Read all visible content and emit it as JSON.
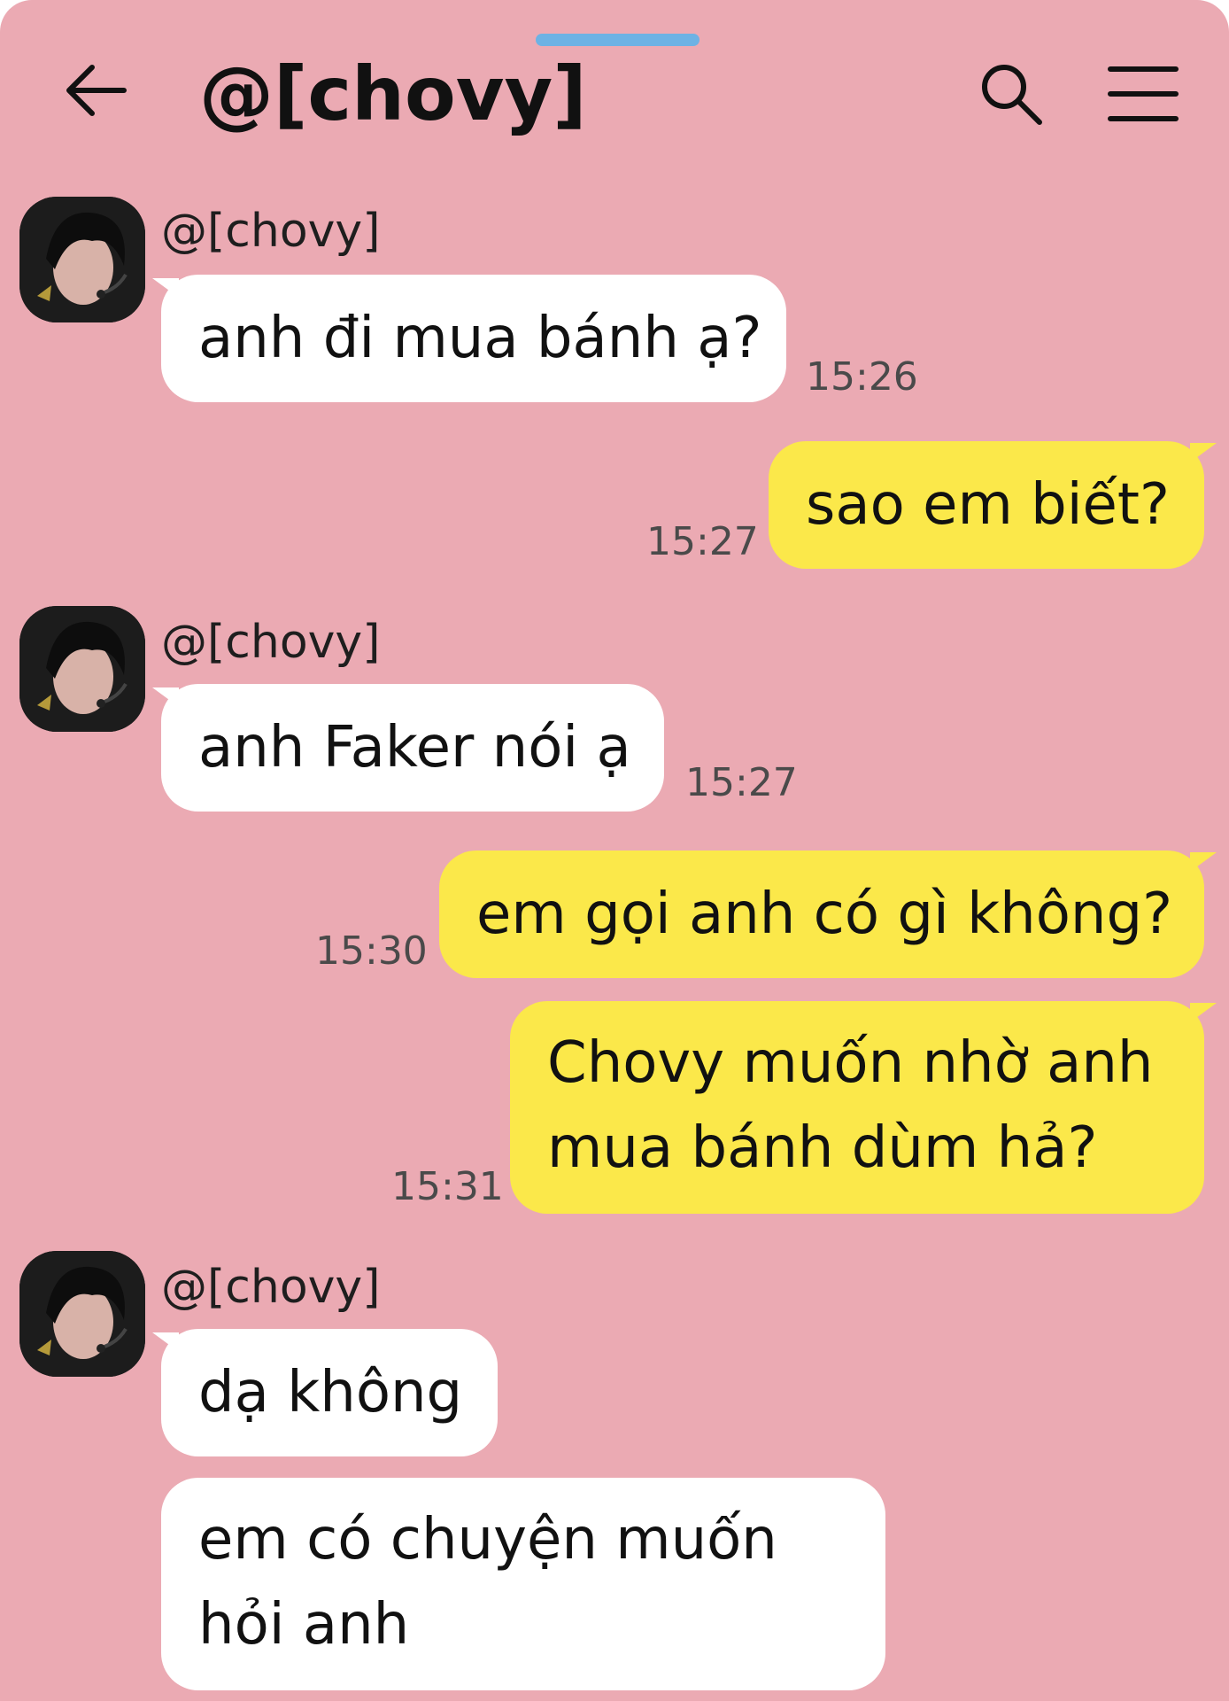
{
  "header": {
    "title": "@[chovy]",
    "back_icon": "arrow-left-icon",
    "search_icon": "search-icon",
    "menu_icon": "hamburger-menu-icon"
  },
  "colors": {
    "background": "#ebaab3",
    "incoming_bubble": "#ffffff",
    "outgoing_bubble": "#fbe84a",
    "handle": "#6db2e4"
  },
  "messages": [
    {
      "group": 1,
      "sender": "@[chovy]",
      "text": "anh đi mua bánh ạ?",
      "time": "15:26",
      "direction": "in"
    },
    {
      "text": "sao em biết?",
      "time": "15:27",
      "direction": "out"
    },
    {
      "group": 2,
      "sender": "@[chovy]",
      "text": "anh Faker nói ạ",
      "time": "15:27",
      "direction": "in"
    },
    {
      "text": "em gọi anh có gì không?",
      "time": "15:30",
      "direction": "out"
    },
    {
      "lines": [
        "Chovy muốn nhờ anh",
        "mua bánh dùm hả?"
      ],
      "time": "15:31",
      "direction": "out"
    },
    {
      "group": 3,
      "sender": "@[chovy]",
      "text": "dạ không",
      "direction": "in"
    },
    {
      "lines": [
        "em có chuyện muốn",
        "hỏi anh"
      ],
      "direction": "in"
    }
  ]
}
